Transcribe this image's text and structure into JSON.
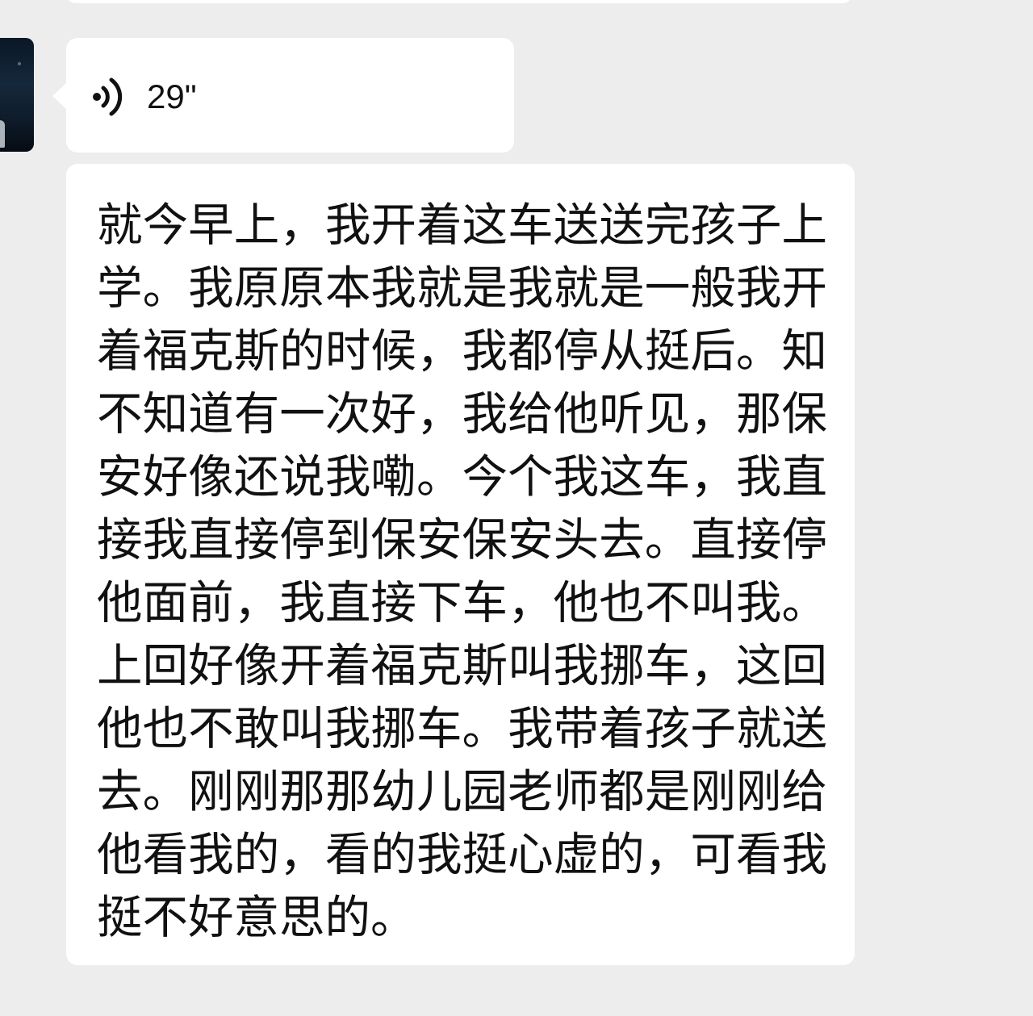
{
  "chat": {
    "voice_message": {
      "icon": "voice-wave-icon",
      "duration": "29\""
    },
    "text_message": {
      "content": "就今早上，我开着这车送送完孩子上学。我原原本我就是我就是一般我开着福克斯的时候，我都停从挺后。知不知道有一次好，我给他听见，那保安好像还说我嘞。今个我这车，我直接我直接停到保安保安头去。直接停他面前，我直接下车，他也不叫我。上回好像开着福克斯叫我挪车，这回他也不敢叫我挪车。我带着孩子就送去。刚刚那那幼儿园老师都是刚刚给他看我的，看的我挺心虚的，可看我挺不好意思的。"
    }
  },
  "colors": {
    "background": "#ededed",
    "bubble": "#ffffff",
    "text": "#111111"
  }
}
